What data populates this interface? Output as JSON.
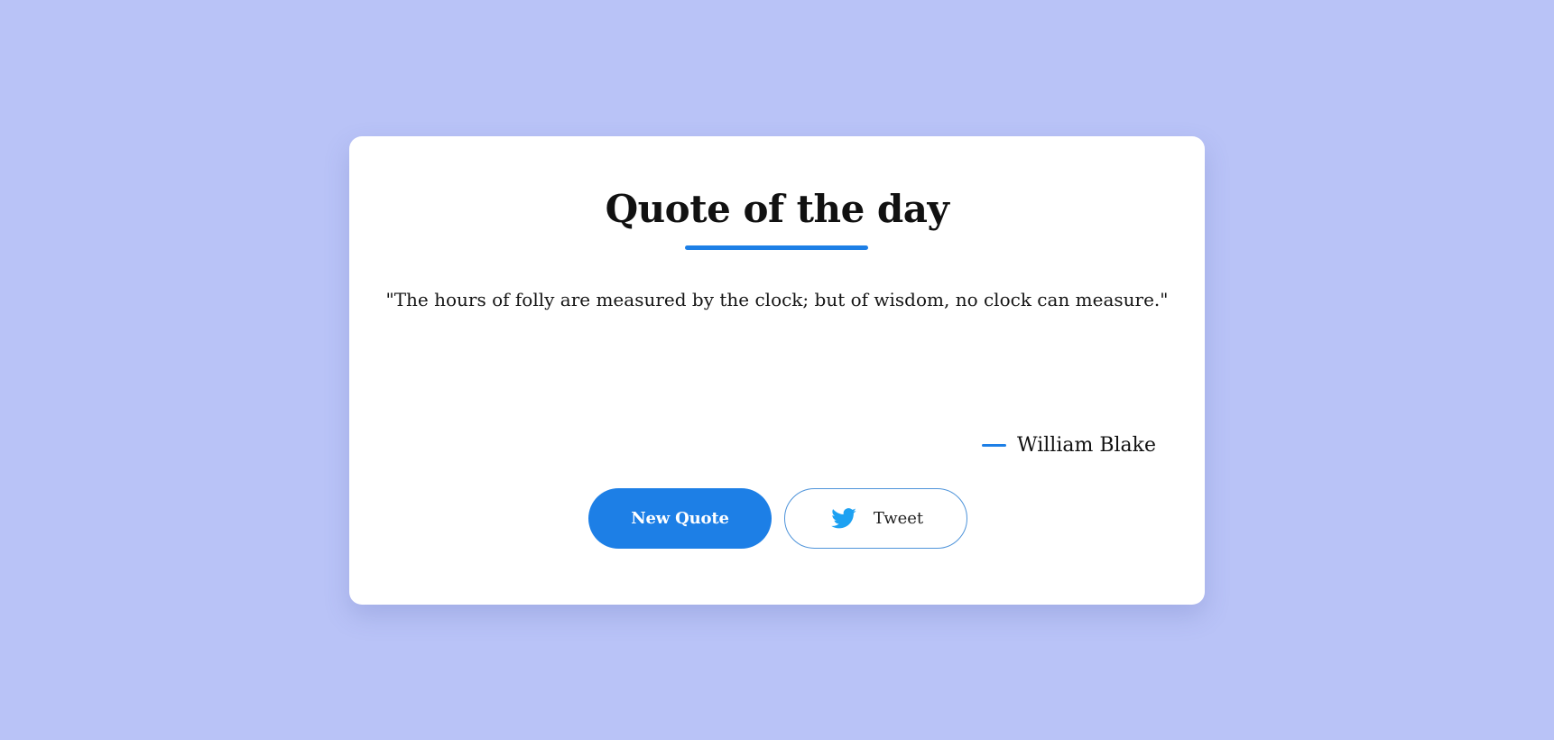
{
  "card": {
    "title": "Quote of the day",
    "quote": "\"The hours of folly are measured by the clock; but of wisdom, no clock can measure.\"",
    "author": "William Blake"
  },
  "buttons": {
    "new_quote_label": "New Quote",
    "tweet_label": "Tweet",
    "tweet_icon": "twitter-bird-icon"
  },
  "colors": {
    "background": "#b9c3f7",
    "accent": "#1d7fe6",
    "card": "#ffffff",
    "twitter": "#1da1f2"
  }
}
